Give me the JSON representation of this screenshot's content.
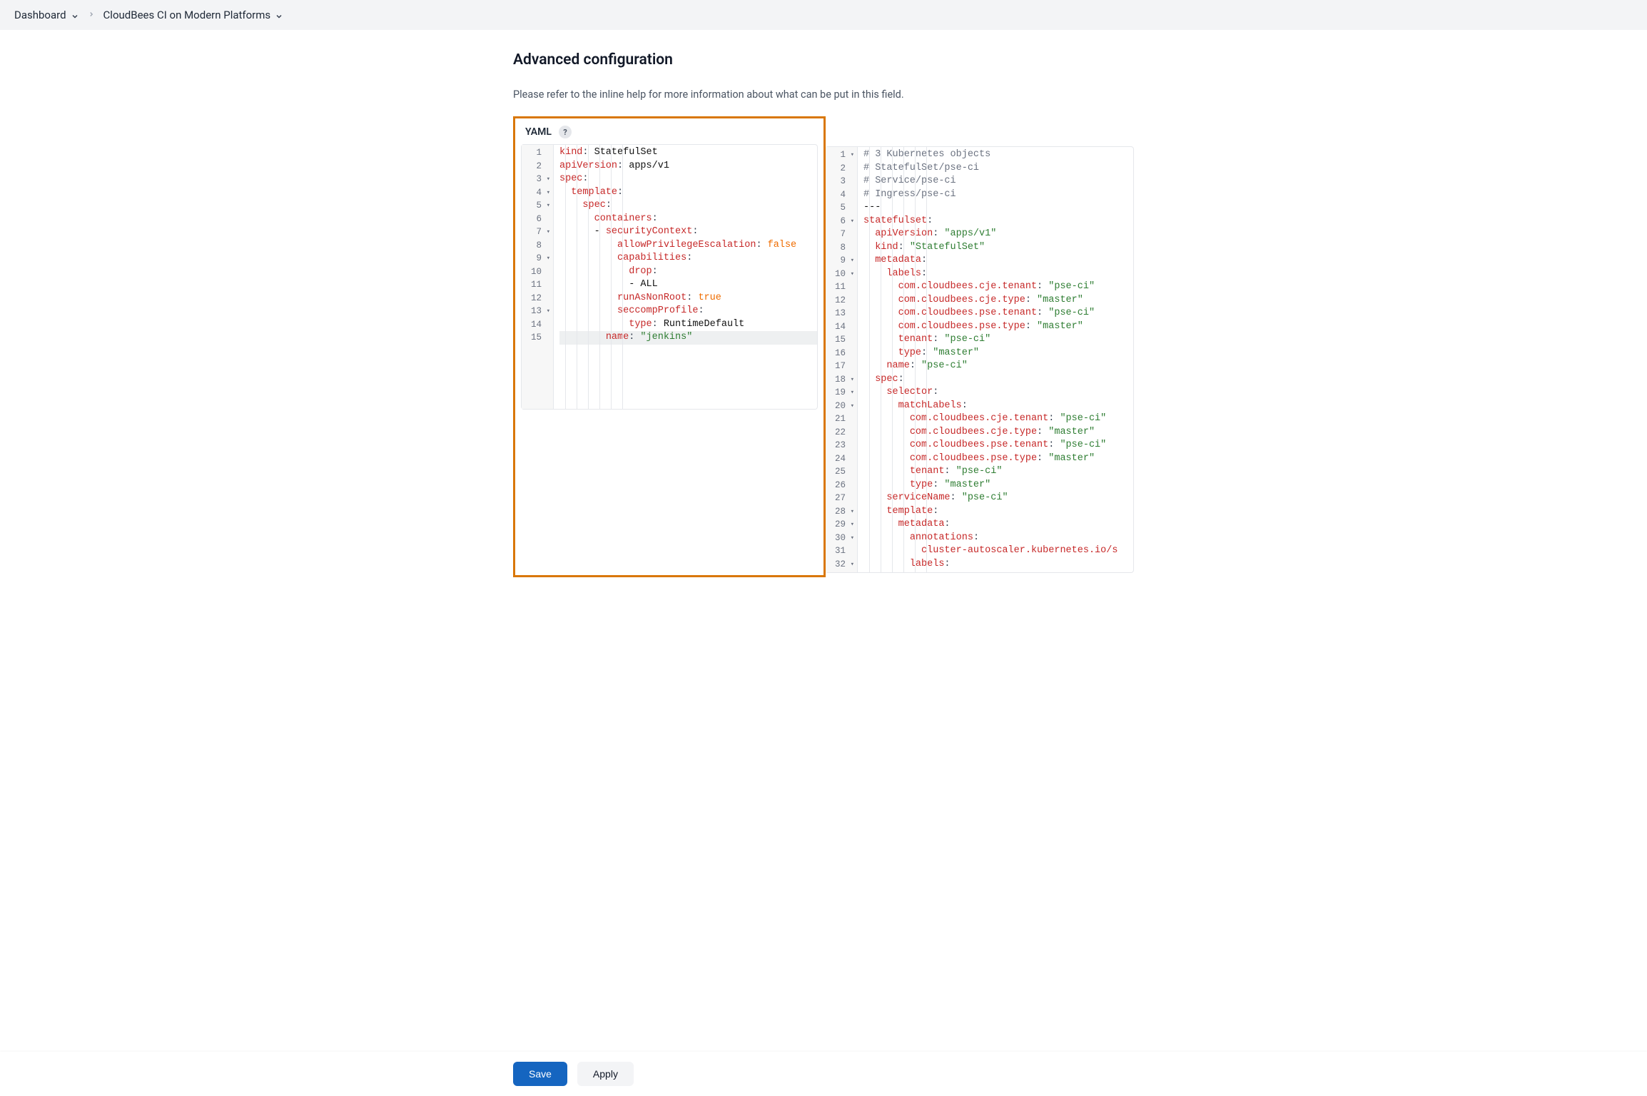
{
  "breadcrumb": {
    "items": [
      "Dashboard",
      "CloudBees CI on Modern Platforms"
    ]
  },
  "page": {
    "title": "Advanced configuration",
    "help_text": "Please refer to the inline help for more information about what can be put in this field.",
    "yaml_label": "YAML",
    "help_icon": "?"
  },
  "buttons": {
    "save": "Save",
    "apply": "Apply"
  },
  "editor_left": {
    "lines": [
      {
        "n": 1,
        "fold": false,
        "tokens": [
          [
            "key",
            "kind"
          ],
          [
            "punc",
            ": "
          ],
          [
            "plain",
            "StatefulSet"
          ]
        ]
      },
      {
        "n": 2,
        "fold": false,
        "tokens": [
          [
            "key",
            "apiVersion"
          ],
          [
            "punc",
            ": "
          ],
          [
            "plain",
            "apps/v1"
          ]
        ]
      },
      {
        "n": 3,
        "fold": true,
        "tokens": [
          [
            "key",
            "spec"
          ],
          [
            "punc",
            ":"
          ]
        ]
      },
      {
        "n": 4,
        "fold": true,
        "tokens": [
          [
            "plain",
            "  "
          ],
          [
            "key",
            "template"
          ],
          [
            "punc",
            ":"
          ]
        ]
      },
      {
        "n": 5,
        "fold": true,
        "tokens": [
          [
            "plain",
            "    "
          ],
          [
            "key",
            "spec"
          ],
          [
            "punc",
            ":"
          ]
        ]
      },
      {
        "n": 6,
        "fold": false,
        "tokens": [
          [
            "plain",
            "      "
          ],
          [
            "key",
            "containers"
          ],
          [
            "punc",
            ":"
          ]
        ]
      },
      {
        "n": 7,
        "fold": true,
        "tokens": [
          [
            "plain",
            "      "
          ],
          [
            "dash",
            "- "
          ],
          [
            "key",
            "securityContext"
          ],
          [
            "punc",
            ":"
          ]
        ]
      },
      {
        "n": 8,
        "fold": false,
        "tokens": [
          [
            "plain",
            "          "
          ],
          [
            "key",
            "allowPrivilegeEscalation"
          ],
          [
            "punc",
            ": "
          ],
          [
            "bool",
            "false"
          ]
        ]
      },
      {
        "n": 9,
        "fold": true,
        "tokens": [
          [
            "plain",
            "          "
          ],
          [
            "key",
            "capabilities"
          ],
          [
            "punc",
            ":"
          ]
        ]
      },
      {
        "n": 10,
        "fold": false,
        "tokens": [
          [
            "plain",
            "            "
          ],
          [
            "key",
            "drop"
          ],
          [
            "punc",
            ":"
          ]
        ]
      },
      {
        "n": 11,
        "fold": false,
        "tokens": [
          [
            "plain",
            "            "
          ],
          [
            "dash",
            "- "
          ],
          [
            "plain",
            "ALL"
          ]
        ]
      },
      {
        "n": 12,
        "fold": false,
        "tokens": [
          [
            "plain",
            "          "
          ],
          [
            "key",
            "runAsNonRoot"
          ],
          [
            "punc",
            ": "
          ],
          [
            "bool",
            "true"
          ]
        ]
      },
      {
        "n": 13,
        "fold": true,
        "tokens": [
          [
            "plain",
            "          "
          ],
          [
            "key",
            "seccompProfile"
          ],
          [
            "punc",
            ":"
          ]
        ]
      },
      {
        "n": 14,
        "fold": false,
        "tokens": [
          [
            "plain",
            "            "
          ],
          [
            "key",
            "type"
          ],
          [
            "punc",
            ": "
          ],
          [
            "plain",
            "RuntimeDefault"
          ]
        ]
      },
      {
        "n": 15,
        "fold": false,
        "hl": true,
        "tokens": [
          [
            "plain",
            "        "
          ],
          [
            "key",
            "name"
          ],
          [
            "punc",
            ": "
          ],
          [
            "str",
            "\"jenkins\""
          ]
        ]
      }
    ]
  },
  "editor_right": {
    "lines": [
      {
        "n": 1,
        "fold": true,
        "tokens": [
          [
            "comment",
            "# 3 Kubernetes objects"
          ]
        ]
      },
      {
        "n": 2,
        "fold": false,
        "tokens": [
          [
            "comment",
            "# StatefulSet/pse-ci"
          ]
        ]
      },
      {
        "n": 3,
        "fold": false,
        "tokens": [
          [
            "comment",
            "# Service/pse-ci"
          ]
        ]
      },
      {
        "n": 4,
        "fold": false,
        "tokens": [
          [
            "comment",
            "# Ingress/pse-ci"
          ]
        ]
      },
      {
        "n": 5,
        "fold": false,
        "tokens": [
          [
            "dash",
            "---"
          ]
        ]
      },
      {
        "n": 6,
        "fold": true,
        "tokens": [
          [
            "key",
            "statefulset"
          ],
          [
            "punc",
            ":"
          ]
        ]
      },
      {
        "n": 7,
        "fold": false,
        "tokens": [
          [
            "plain",
            "  "
          ],
          [
            "key",
            "apiVersion"
          ],
          [
            "punc",
            ": "
          ],
          [
            "str",
            "\"apps/v1\""
          ]
        ]
      },
      {
        "n": 8,
        "fold": false,
        "tokens": [
          [
            "plain",
            "  "
          ],
          [
            "key",
            "kind"
          ],
          [
            "punc",
            ": "
          ],
          [
            "str",
            "\"StatefulSet\""
          ]
        ]
      },
      {
        "n": 9,
        "fold": true,
        "tokens": [
          [
            "plain",
            "  "
          ],
          [
            "key",
            "metadata"
          ],
          [
            "punc",
            ":"
          ]
        ]
      },
      {
        "n": 10,
        "fold": true,
        "tokens": [
          [
            "plain",
            "    "
          ],
          [
            "key",
            "labels"
          ],
          [
            "punc",
            ":"
          ]
        ]
      },
      {
        "n": 11,
        "fold": false,
        "tokens": [
          [
            "plain",
            "      "
          ],
          [
            "key",
            "com.cloudbees.cje.tenant"
          ],
          [
            "punc",
            ": "
          ],
          [
            "str",
            "\"pse-ci\""
          ]
        ]
      },
      {
        "n": 12,
        "fold": false,
        "tokens": [
          [
            "plain",
            "      "
          ],
          [
            "key",
            "com.cloudbees.cje.type"
          ],
          [
            "punc",
            ": "
          ],
          [
            "str",
            "\"master\""
          ]
        ]
      },
      {
        "n": 13,
        "fold": false,
        "tokens": [
          [
            "plain",
            "      "
          ],
          [
            "key",
            "com.cloudbees.pse.tenant"
          ],
          [
            "punc",
            ": "
          ],
          [
            "str",
            "\"pse-ci\""
          ]
        ]
      },
      {
        "n": 14,
        "fold": false,
        "tokens": [
          [
            "plain",
            "      "
          ],
          [
            "key",
            "com.cloudbees.pse.type"
          ],
          [
            "punc",
            ": "
          ],
          [
            "str",
            "\"master\""
          ]
        ]
      },
      {
        "n": 15,
        "fold": false,
        "tokens": [
          [
            "plain",
            "      "
          ],
          [
            "key",
            "tenant"
          ],
          [
            "punc",
            ": "
          ],
          [
            "str",
            "\"pse-ci\""
          ]
        ]
      },
      {
        "n": 16,
        "fold": false,
        "tokens": [
          [
            "plain",
            "      "
          ],
          [
            "key",
            "type"
          ],
          [
            "punc",
            ": "
          ],
          [
            "str",
            "\"master\""
          ]
        ]
      },
      {
        "n": 17,
        "fold": false,
        "tokens": [
          [
            "plain",
            "    "
          ],
          [
            "key",
            "name"
          ],
          [
            "punc",
            ": "
          ],
          [
            "str",
            "\"pse-ci\""
          ]
        ]
      },
      {
        "n": 18,
        "fold": true,
        "tokens": [
          [
            "plain",
            "  "
          ],
          [
            "key",
            "spec"
          ],
          [
            "punc",
            ":"
          ]
        ]
      },
      {
        "n": 19,
        "fold": true,
        "tokens": [
          [
            "plain",
            "    "
          ],
          [
            "key",
            "selector"
          ],
          [
            "punc",
            ":"
          ]
        ]
      },
      {
        "n": 20,
        "fold": true,
        "tokens": [
          [
            "plain",
            "      "
          ],
          [
            "key",
            "matchLabels"
          ],
          [
            "punc",
            ":"
          ]
        ]
      },
      {
        "n": 21,
        "fold": false,
        "tokens": [
          [
            "plain",
            "        "
          ],
          [
            "key",
            "com.cloudbees.cje.tenant"
          ],
          [
            "punc",
            ": "
          ],
          [
            "str",
            "\"pse-ci\""
          ]
        ]
      },
      {
        "n": 22,
        "fold": false,
        "tokens": [
          [
            "plain",
            "        "
          ],
          [
            "key",
            "com.cloudbees.cje.type"
          ],
          [
            "punc",
            ": "
          ],
          [
            "str",
            "\"master\""
          ]
        ]
      },
      {
        "n": 23,
        "fold": false,
        "tokens": [
          [
            "plain",
            "        "
          ],
          [
            "key",
            "com.cloudbees.pse.tenant"
          ],
          [
            "punc",
            ": "
          ],
          [
            "str",
            "\"pse-ci\""
          ]
        ]
      },
      {
        "n": 24,
        "fold": false,
        "tokens": [
          [
            "plain",
            "        "
          ],
          [
            "key",
            "com.cloudbees.pse.type"
          ],
          [
            "punc",
            ": "
          ],
          [
            "str",
            "\"master\""
          ]
        ]
      },
      {
        "n": 25,
        "fold": false,
        "tokens": [
          [
            "plain",
            "        "
          ],
          [
            "key",
            "tenant"
          ],
          [
            "punc",
            ": "
          ],
          [
            "str",
            "\"pse-ci\""
          ]
        ]
      },
      {
        "n": 26,
        "fold": false,
        "tokens": [
          [
            "plain",
            "        "
          ],
          [
            "key",
            "type"
          ],
          [
            "punc",
            ": "
          ],
          [
            "str",
            "\"master\""
          ]
        ]
      },
      {
        "n": 27,
        "fold": false,
        "tokens": [
          [
            "plain",
            "    "
          ],
          [
            "key",
            "serviceName"
          ],
          [
            "punc",
            ": "
          ],
          [
            "str",
            "\"pse-ci\""
          ]
        ]
      },
      {
        "n": 28,
        "fold": true,
        "tokens": [
          [
            "plain",
            "    "
          ],
          [
            "key",
            "template"
          ],
          [
            "punc",
            ":"
          ]
        ]
      },
      {
        "n": 29,
        "fold": true,
        "tokens": [
          [
            "plain",
            "      "
          ],
          [
            "key",
            "metadata"
          ],
          [
            "punc",
            ":"
          ]
        ]
      },
      {
        "n": 30,
        "fold": true,
        "tokens": [
          [
            "plain",
            "        "
          ],
          [
            "key",
            "annotations"
          ],
          [
            "punc",
            ":"
          ]
        ]
      },
      {
        "n": 31,
        "fold": false,
        "tokens": [
          [
            "plain",
            "          "
          ],
          [
            "key",
            "cluster-autoscaler.kubernetes.io/s"
          ]
        ]
      },
      {
        "n": 32,
        "fold": true,
        "tokens": [
          [
            "plain",
            "        "
          ],
          [
            "key",
            "labels"
          ],
          [
            "punc",
            ":"
          ]
        ]
      }
    ]
  }
}
